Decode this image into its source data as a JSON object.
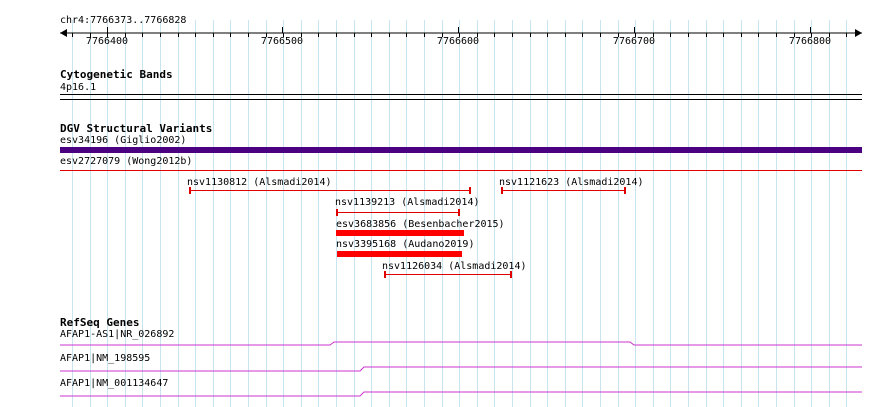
{
  "ruler": {
    "region_label": "chr4:7766373..7766828",
    "ticks": [
      "7766400",
      "7766500",
      "7766600",
      "7766700",
      "7766800"
    ]
  },
  "tracks": {
    "cytoband": {
      "title": "Cytogenetic Bands",
      "band_label": "4p16.1"
    },
    "dgv": {
      "title": "DGV Structural Variants",
      "features": [
        {
          "label": "esv34196 (Giglio2002)",
          "color": "#4b0082",
          "style": "thick-bar"
        },
        {
          "label": "esv2727079 (Wong2012b)",
          "color": "#e00000",
          "style": "thin-line"
        },
        {
          "label": "nsv1130812 (Alsmadi2014)",
          "color": "#e00000",
          "style": "bracket"
        },
        {
          "label": "nsv1121623 (Alsmadi2014)",
          "color": "#e00000",
          "style": "bracket"
        },
        {
          "label": "nsv1139213 (Alsmadi2014)",
          "color": "#e00000",
          "style": "bracket"
        },
        {
          "label": "esv3683856 (Besenbacher2015)",
          "color": "#ff0000",
          "style": "solid-bar"
        },
        {
          "label": "nsv3395168 (Audano2019)",
          "color": "#ff0000",
          "style": "solid-bar"
        },
        {
          "label": "nsv1126034 (Alsmadi2014)",
          "color": "#e00000",
          "style": "bracket"
        }
      ]
    },
    "refseq": {
      "title": "RefSeq Genes",
      "transcript_color": "#cc33cc",
      "transcripts": [
        {
          "label": "AFAP1-AS1|NR_026892"
        },
        {
          "label": "AFAP1|NM_198595"
        },
        {
          "label": "AFAP1|NM_001134647"
        }
      ]
    }
  }
}
